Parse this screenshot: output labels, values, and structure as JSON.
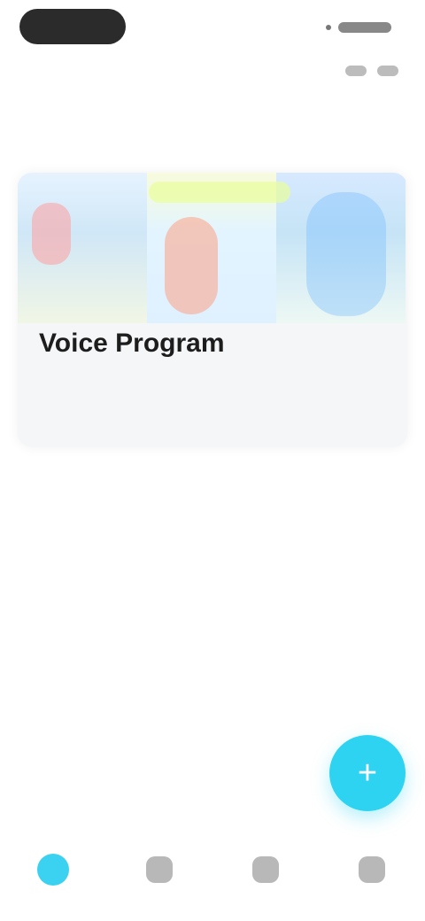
{
  "top": {
    "pill_label": "",
    "status_right": "",
    "small_actions": [
      "",
      ""
    ]
  },
  "section": {
    "title": ""
  },
  "card": {
    "title": "Voice Program",
    "line1": "",
    "line2": "",
    "line3": ""
  },
  "bottom": {
    "caption": ""
  },
  "fab": {
    "icon": "plus-icon",
    "label": ""
  },
  "tabs": [
    {
      "icon": "home-icon",
      "label": ""
    },
    {
      "icon": "gallery-icon",
      "label": ""
    },
    {
      "icon": "chat-icon",
      "label": ""
    },
    {
      "icon": "profile-icon",
      "label": ""
    }
  ]
}
